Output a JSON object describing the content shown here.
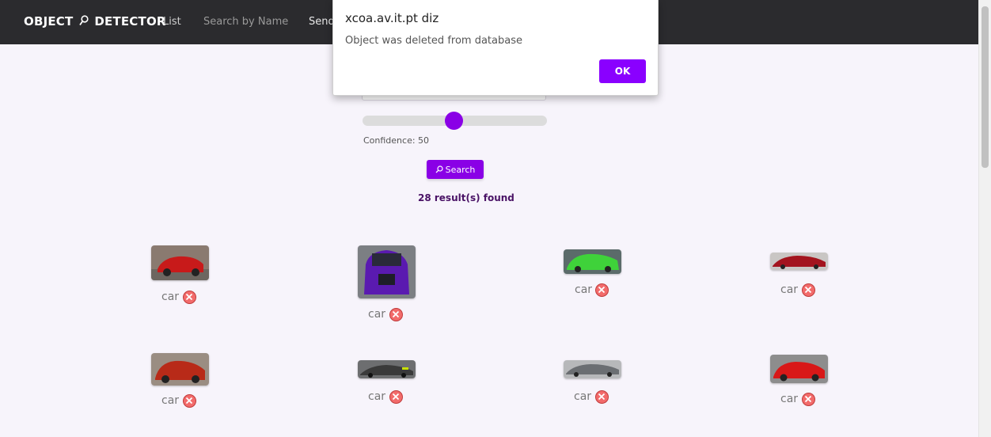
{
  "nav": {
    "brand_left": "OBJECT",
    "brand_right": "DETECTOR",
    "links": [
      "List",
      "Search by Name",
      "Send"
    ]
  },
  "search": {
    "confidence_label": "Confidence: 50",
    "confidence_value": 50,
    "button_label": "Search",
    "results_text": "28 result(s) found"
  },
  "results": [
    {
      "label": "car",
      "color": "#c81a1a",
      "icon": "red-car-photo"
    },
    {
      "label": "car",
      "color": "#5a1ab0",
      "icon": "purple-car-photo"
    },
    {
      "label": "car",
      "color": "#3fd23a",
      "icon": "green-car-photo"
    },
    {
      "label": "car",
      "color": "#a3141e",
      "icon": "red-sedan-photo"
    },
    {
      "label": "car",
      "color": "#b82a18",
      "icon": "red-suv-photo"
    },
    {
      "label": "car",
      "color": "#3a3a3a",
      "icon": "dark-supercar-photo"
    },
    {
      "label": "car",
      "color": "#6b6e72",
      "icon": "gray-sedan-photo"
    },
    {
      "label": "car",
      "color": "#d81818",
      "icon": "red-sportscar-photo"
    }
  ],
  "dialog": {
    "title": "xcoa.av.it.pt diz",
    "message": "Object was deleted from database",
    "ok_label": "OK"
  },
  "colors": {
    "accent": "#8a00e6",
    "navbar": "#2b2b2e",
    "background": "#f7f4fb",
    "delete": "#f26b6b"
  }
}
